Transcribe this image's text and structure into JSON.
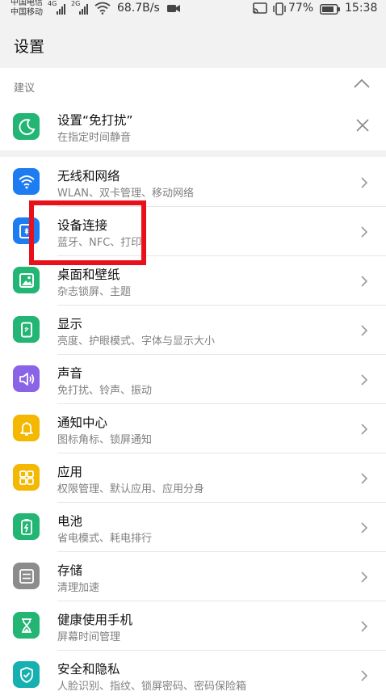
{
  "status_bar": {
    "carrier_top": "中国电信",
    "carrier_bottom": "中国移动",
    "sig1_tag": "4G",
    "sig2_tag": "2G",
    "net_speed": "68.7B/s",
    "battery_percent": "77%",
    "time": "15:38"
  },
  "header": {
    "title": "设置"
  },
  "suggestion": {
    "section_label": "建议",
    "item": {
      "title": "设置“免打扰”",
      "subtitle": "在指定时间静音"
    }
  },
  "settings": [
    {
      "title": "无线和网络",
      "subtitle": "WLAN、双卡管理、移动网络",
      "icon": "wifi-icon",
      "color": "#1e7cf2"
    },
    {
      "title": "设备连接",
      "subtitle": "蓝牙、NFC、打印",
      "icon": "device-connect-icon",
      "color": "#1e7cf2"
    },
    {
      "title": "桌面和壁纸",
      "subtitle": "杂志锁屏、主题",
      "icon": "wallpaper-icon",
      "color": "#22b573"
    },
    {
      "title": "显示",
      "subtitle": "亮度、护眼模式、字体与显示大小",
      "icon": "display-icon",
      "color": "#22b573"
    },
    {
      "title": "声音",
      "subtitle": "免打扰、铃声、振动",
      "icon": "sound-icon",
      "color": "#8a63e6"
    },
    {
      "title": "通知中心",
      "subtitle": "图标角标、锁屏通知",
      "icon": "bell-icon",
      "color": "#f5b800"
    },
    {
      "title": "应用",
      "subtitle": "权限管理、默认应用、应用分身",
      "icon": "apps-icon",
      "color": "#f5b800"
    },
    {
      "title": "电池",
      "subtitle": "省电模式、耗电排行",
      "icon": "battery-icon",
      "color": "#22b573"
    },
    {
      "title": "存储",
      "subtitle": "清理加速",
      "icon": "storage-icon",
      "color": "#8c8c8c"
    },
    {
      "title": "健康使用手机",
      "subtitle": "屏幕时间管理",
      "icon": "hourglass-icon",
      "color": "#22b573"
    },
    {
      "title": "安全和隐私",
      "subtitle": "人脸识别、指纹、锁屏密码、密码保险箱",
      "icon": "shield-icon",
      "color": "#16b0b0"
    }
  ],
  "colors": {
    "highlight": "#e8101a",
    "moon_bg": "#22b573"
  }
}
